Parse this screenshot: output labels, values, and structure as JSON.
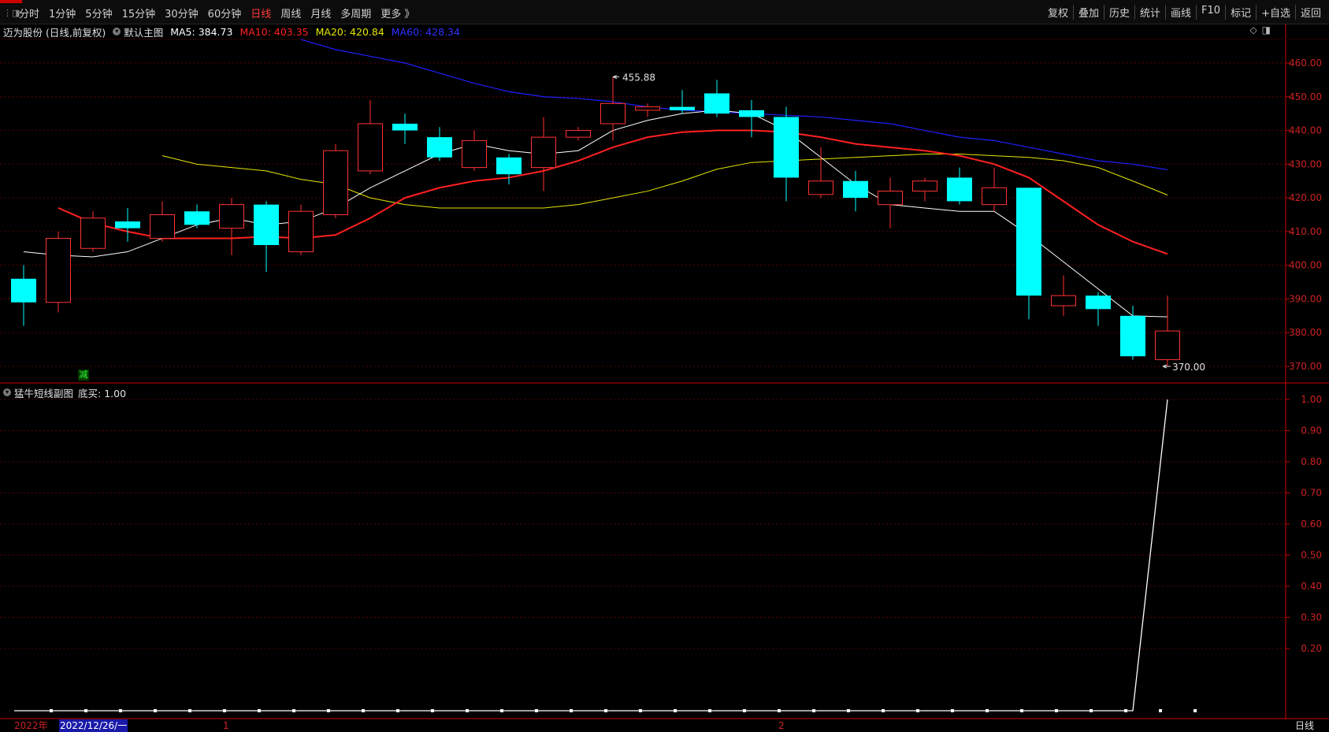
{
  "toolbar": {
    "periods": [
      "分时",
      "1分钟",
      "5分钟",
      "15分钟",
      "30分钟",
      "60分钟",
      "日线",
      "周线",
      "月线",
      "多周期",
      "更多 》"
    ],
    "active_period": "日线",
    "right_tools": [
      "复权",
      "叠加",
      "历史",
      "统计",
      "画线",
      "F10",
      "标记",
      "+自选",
      "返回"
    ]
  },
  "main": {
    "stock": "迈为股份 (日线,前复权)",
    "indicator": "默认主图",
    "ma5": "MA5: 384.73",
    "ma10": "MA10: 403.35",
    "ma20": "MA20: 420.84",
    "ma60": "MA60: 428.34",
    "high_label": "455.88",
    "low_label": "370.00",
    "signal_label": "减"
  },
  "sub": {
    "indicator": "猛牛短线副图",
    "value": "底买: 1.00"
  },
  "bottom": {
    "year": "2022年",
    "date": "2022/12/26/一",
    "m1": "1",
    "m2": "2",
    "period": "日线"
  },
  "colors": {
    "up": "#ff3232",
    "down": "#00ffff",
    "ma5": "#ffffff",
    "ma10": "#ff2020",
    "ma20": "#e6e600",
    "ma60": "#2020ff",
    "axis": "#cc0000"
  },
  "chart_data": [
    {
      "type": "candlestick",
      "title": "迈为股份 (日线,前复权)",
      "ylim": [
        365,
        465
      ],
      "y_ticks": [
        370,
        380,
        390,
        400,
        410,
        420,
        430,
        440,
        450,
        460
      ],
      "candles": [
        {
          "o": 396,
          "h": 400,
          "l": 382,
          "c": 389
        },
        {
          "o": 389,
          "h": 410,
          "l": 386,
          "c": 408
        },
        {
          "o": 405,
          "h": 416,
          "l": 404,
          "c": 414
        },
        {
          "o": 413,
          "h": 417,
          "l": 407,
          "c": 411
        },
        {
          "o": 408,
          "h": 419,
          "l": 407,
          "c": 415
        },
        {
          "o": 416,
          "h": 418,
          "l": 411,
          "c": 412
        },
        {
          "o": 411,
          "h": 420,
          "l": 403,
          "c": 418
        },
        {
          "o": 418,
          "h": 419,
          "l": 398,
          "c": 406
        },
        {
          "o": 404,
          "h": 418,
          "l": 403,
          "c": 416
        },
        {
          "o": 415,
          "h": 436,
          "l": 414,
          "c": 434
        },
        {
          "o": 428,
          "h": 449,
          "l": 427,
          "c": 442
        },
        {
          "o": 442,
          "h": 445,
          "l": 436,
          "c": 440
        },
        {
          "o": 438,
          "h": 441,
          "l": 431,
          "c": 432
        },
        {
          "o": 429,
          "h": 440,
          "l": 428,
          "c": 437
        },
        {
          "o": 432,
          "h": 433,
          "l": 424,
          "c": 427
        },
        {
          "o": 429,
          "h": 444,
          "l": 422,
          "c": 438
        },
        {
          "o": 438,
          "h": 441,
          "l": 437,
          "c": 440
        },
        {
          "o": 442,
          "h": 455.88,
          "l": 437,
          "c": 448
        },
        {
          "o": 446,
          "h": 448,
          "l": 444,
          "c": 447
        },
        {
          "o": 447,
          "h": 452,
          "l": 445,
          "c": 446
        },
        {
          "o": 451,
          "h": 455,
          "l": 444,
          "c": 445
        },
        {
          "o": 446,
          "h": 449,
          "l": 438,
          "c": 444
        },
        {
          "o": 444,
          "h": 447,
          "l": 419,
          "c": 426
        },
        {
          "o": 421,
          "h": 435,
          "l": 420,
          "c": 425
        },
        {
          "o": 425,
          "h": 428,
          "l": 416,
          "c": 420
        },
        {
          "o": 418,
          "h": 426,
          "l": 411,
          "c": 422
        },
        {
          "o": 422,
          "h": 426,
          "l": 419,
          "c": 425
        },
        {
          "o": 426,
          "h": 429,
          "l": 418,
          "c": 419
        },
        {
          "o": 418,
          "h": 429,
          "l": 416,
          "c": 423
        },
        {
          "o": 423,
          "h": 423,
          "l": 384,
          "c": 391
        },
        {
          "o": 388,
          "h": 397,
          "l": 385,
          "c": 391
        },
        {
          "o": 391,
          "h": 392,
          "l": 382,
          "c": 387
        },
        {
          "o": 385,
          "h": 388,
          "l": 372,
          "c": 373
        },
        {
          "o": 372,
          "h": 391,
          "l": 370,
          "c": 380.5
        }
      ],
      "ma": {
        "MA5": [
          404,
          403,
          402.5,
          404,
          408,
          412,
          414,
          412,
          413,
          417,
          423,
          428,
          433,
          436,
          434,
          433,
          434,
          440,
          443,
          445,
          446,
          445,
          440,
          432,
          424,
          418,
          417,
          416,
          416,
          409,
          401,
          393,
          385,
          384.7
        ],
        "MA10": [
          417,
          412.5,
          410,
          408,
          408,
          408,
          408.5,
          408,
          409,
          414,
          420,
          423,
          425,
          426,
          428,
          431,
          435,
          438,
          439.5,
          440,
          440,
          439.5,
          438,
          436,
          435,
          434,
          432.5,
          430,
          426,
          419,
          412,
          407,
          403.35
        ],
        "MA20": [
          432.5,
          430,
          429,
          428,
          425.5,
          424,
          420,
          418,
          417,
          417,
          417,
          417,
          418,
          420,
          422,
          425,
          428.5,
          430.5,
          431,
          431.5,
          432,
          432.5,
          433,
          433,
          432.5,
          432,
          431,
          429,
          425,
          420.84
        ],
        "MA60": [
          467,
          464,
          462,
          460,
          457,
          454,
          451.5,
          450,
          449.5,
          448.5,
          447,
          446,
          445.5,
          445,
          444.5,
          444,
          443,
          442,
          440,
          438,
          437,
          435,
          433,
          431,
          430,
          428.34
        ]
      }
    },
    {
      "type": "line",
      "title": "猛牛短线副图",
      "series": [
        {
          "name": "底买",
          "values": [
            0,
            0,
            0,
            0,
            0,
            0,
            0,
            0,
            0,
            0,
            0,
            0,
            0,
            0,
            0,
            0,
            0,
            0,
            0,
            0,
            0,
            0,
            0,
            0,
            0,
            0,
            0,
            0,
            0,
            0,
            0,
            0,
            0,
            1.0
          ]
        }
      ],
      "ylim": [
        0,
        1.0
      ],
      "y_ticks": [
        0.2,
        0.3,
        0.4,
        0.5,
        0.6,
        0.7,
        0.8,
        0.9,
        1.0
      ]
    }
  ]
}
